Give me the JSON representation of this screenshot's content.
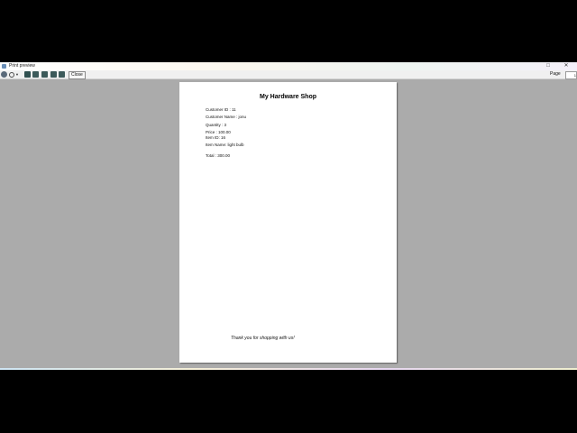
{
  "window": {
    "title": "Print preview"
  },
  "toolbar": {
    "close_label": "Close",
    "page_label": "Page",
    "page_value": "1"
  },
  "receipt": {
    "shop_name": "My Hardware Shop",
    "customer_id": "Customer ID : 11",
    "customer_name": "Customer Name : jonu",
    "quantity": "Quantity : 3",
    "price": "Price : 100.00",
    "item_id": "Item ID: 16",
    "item_name": "Item Name: light bulb",
    "total": "Total : 300.00",
    "footer": "Thank you for shopping with us!"
  }
}
